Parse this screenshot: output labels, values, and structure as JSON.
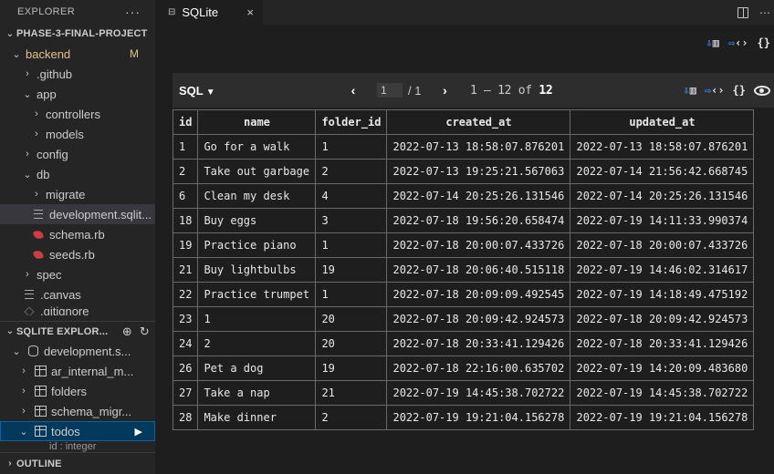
{
  "explorer": {
    "title": "EXPLORER",
    "more": "···",
    "project": "PHASE-3-FINAL-PROJECT",
    "tree": [
      {
        "label": "backend",
        "depth": 1,
        "type": "folder-open",
        "modified": true,
        "badge": "M"
      },
      {
        "label": ".github",
        "depth": 2,
        "type": "folder"
      },
      {
        "label": "app",
        "depth": 2,
        "type": "folder-open"
      },
      {
        "label": "controllers",
        "depth": 3,
        "type": "folder"
      },
      {
        "label": "models",
        "depth": 3,
        "type": "folder"
      },
      {
        "label": "config",
        "depth": 2,
        "type": "folder"
      },
      {
        "label": "db",
        "depth": 2,
        "type": "folder-open"
      },
      {
        "label": "migrate",
        "depth": 3,
        "type": "folder"
      },
      {
        "label": "development.sqlit...",
        "depth": 3,
        "type": "file-db",
        "selected": true
      },
      {
        "label": "schema.rb",
        "depth": 3,
        "type": "file-ruby"
      },
      {
        "label": "seeds.rb",
        "depth": 3,
        "type": "file-ruby"
      },
      {
        "label": "spec",
        "depth": 2,
        "type": "folder"
      },
      {
        "label": ".canvas",
        "depth": 2,
        "type": "file-lines"
      },
      {
        "label": ".gitignore",
        "depth": 2,
        "type": "file-git"
      }
    ]
  },
  "sqlite_explorer": {
    "title": "SQLITE EXPLOR...",
    "database": "development.s...",
    "tables": [
      "ar_internal_m...",
      "folders",
      "schema_migr...",
      "todos"
    ],
    "selected_table": "todos",
    "peek_label": "id : integer"
  },
  "outline": {
    "title": "OUTLINE"
  },
  "editor": {
    "tab_title": "SQLite",
    "tab_close": "×",
    "query_mode": "SQL",
    "page_current": "1",
    "page_total": "/ 1",
    "range_start": "1",
    "range_end": "12",
    "range_of": "of",
    "total_rows": "12"
  },
  "grid": {
    "columns": [
      "id",
      "name",
      "folder_id",
      "created_at",
      "updated_at"
    ],
    "rows": [
      [
        "1",
        "Go for a walk",
        "1",
        "2022-07-13 18:58:07.876201",
        "2022-07-13 18:58:07.876201"
      ],
      [
        "2",
        "Take out garbage",
        "2",
        "2022-07-13 19:25:21.567063",
        "2022-07-14 21:56:42.668745"
      ],
      [
        "6",
        "Clean my desk",
        "4",
        "2022-07-14 20:25:26.131546",
        "2022-07-14 20:25:26.131546"
      ],
      [
        "18",
        "Buy eggs",
        "3",
        "2022-07-18 19:56:20.658474",
        "2022-07-19 14:11:33.990374"
      ],
      [
        "19",
        "Practice piano",
        "1",
        "2022-07-18 20:00:07.433726",
        "2022-07-18 20:00:07.433726"
      ],
      [
        "21",
        "Buy lightbulbs",
        "19",
        "2022-07-18 20:06:40.515118",
        "2022-07-19 14:46:02.314617"
      ],
      [
        "22",
        "Practice trumpet",
        "1",
        "2022-07-18 20:09:09.492545",
        "2022-07-19 14:18:49.475192"
      ],
      [
        "23",
        "1",
        "20",
        "2022-07-18 20:09:42.924573",
        "2022-07-18 20:09:42.924573"
      ],
      [
        "24",
        "2",
        "20",
        "2022-07-18 20:33:41.129426",
        "2022-07-18 20:33:41.129426"
      ],
      [
        "26",
        "Pet a dog",
        "19",
        "2022-07-18 22:16:00.635702",
        "2022-07-19 14:20:09.483680"
      ],
      [
        "27",
        "Take a nap",
        "21",
        "2022-07-19 14:45:38.702722",
        "2022-07-19 14:45:38.702722"
      ],
      [
        "28",
        "Make dinner",
        "2",
        "2022-07-19 19:21:04.156278",
        "2022-07-19 19:21:04.156278"
      ]
    ]
  },
  "colors": {
    "sidebar_bg": "#252526",
    "editor_bg": "#1e1e1e",
    "selection": "#04395e",
    "modified": "#e2c08d",
    "ruby": "#cc3e44",
    "accent_blue": "#3794ff"
  }
}
